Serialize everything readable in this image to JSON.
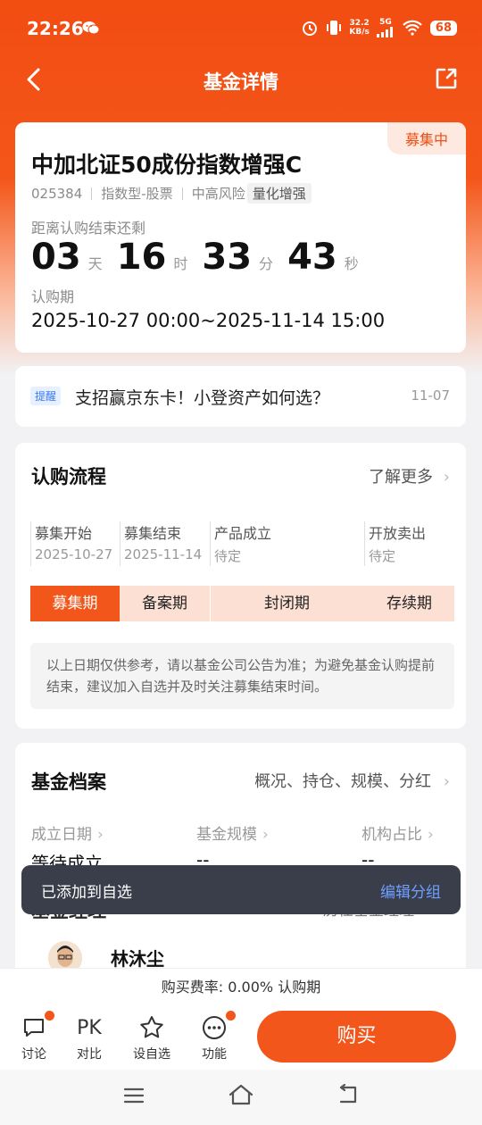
{
  "status": {
    "time": "22:26",
    "net_speed_value": "32.2",
    "net_speed_unit": "KB/s",
    "signal_label": "5G",
    "battery": "68"
  },
  "header": {
    "title": "基金详情"
  },
  "fund": {
    "badge": "募集中",
    "name": "中加北证50成份指数增强C",
    "code": "025384",
    "type": "指数型-股票",
    "risk": "中高风险",
    "tag": "量化增强",
    "countdown_label": "距离认购结束还剩",
    "countdown": {
      "days": "03",
      "days_unit": "天",
      "hours": "16",
      "hours_unit": "时",
      "minutes": "33",
      "minutes_unit": "分",
      "seconds": "43",
      "seconds_unit": "秒"
    },
    "period_label": "认购期",
    "period_value": "2025-10-27 00:00~2025-11-14 15:00"
  },
  "reminder": {
    "tag": "提醒",
    "text": "支招赢京东卡！小登资产如何选？",
    "date": "11-07"
  },
  "process": {
    "title": "认购流程",
    "more": "了解更多",
    "steps": [
      {
        "label": "募集开始",
        "date": "2025-10-27"
      },
      {
        "label": "募集结束",
        "date": "2025-11-14"
      },
      {
        "label": "产品成立",
        "date": "待定"
      },
      {
        "label": "开放卖出",
        "date": "待定"
      }
    ],
    "phases": [
      "募集期",
      "备案期",
      "封闭期",
      "存续期"
    ],
    "note": "以上日期仅供参考，请以基金公司公告为准；为避免基金认购提前结束，建议加入自选并及时关注募集结束时间。"
  },
  "profile": {
    "title": "基金档案",
    "links": "概况、持仓、规模、分红",
    "metrics": [
      {
        "label": "成立日期",
        "value": "等待成立"
      },
      {
        "label": "基金规模",
        "value": "--"
      },
      {
        "label": "机构占比",
        "value": "--"
      }
    ]
  },
  "manager": {
    "title": "基金经理",
    "history": "历任基金经理",
    "name": "林沐尘"
  },
  "toast": {
    "text": "已添加到自选",
    "action": "编辑分组"
  },
  "fee": {
    "text": "购买费率: 0.00% 认购期"
  },
  "actions": {
    "discuss": "讨论",
    "compare_icon": "PK",
    "compare": "对比",
    "watchlist": "设自选",
    "functions": "功能",
    "buy": "购买"
  },
  "colors": {
    "brand": "#f24d12",
    "accent": "#f2561a",
    "link": "#6ea0ff"
  }
}
